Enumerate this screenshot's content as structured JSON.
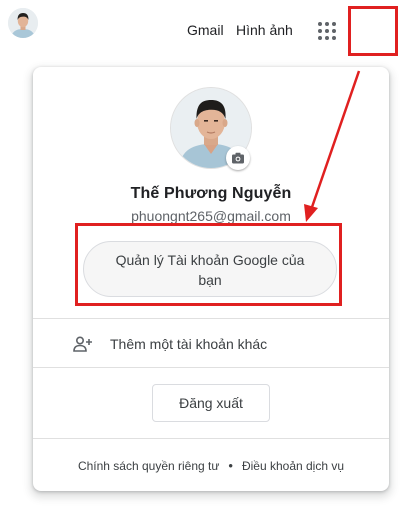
{
  "topbar": {
    "gmail_label": "Gmail",
    "images_label": "Hình ảnh",
    "apps_icon": "apps-grid-icon",
    "avatar_icon": "account-avatar"
  },
  "account_card": {
    "name": "Thế Phương Nguyễn",
    "email": "phuongnt265@gmail.com",
    "camera_icon": "camera-icon",
    "manage_account_label": "Quản lý Tài khoản Google của bạn",
    "add_account_label": "Thêm một tài khoản khác",
    "add_account_icon": "person-add-icon",
    "sign_out_label": "Đăng xuất",
    "privacy_label": "Chính sách quyền riêng tư",
    "separator": "•",
    "terms_label": "Điều khoản dịch vụ"
  },
  "colors": {
    "annotation_red": "#e02020",
    "text_primary": "#202124",
    "text_secondary": "#5f6368",
    "border": "#dadce0"
  }
}
